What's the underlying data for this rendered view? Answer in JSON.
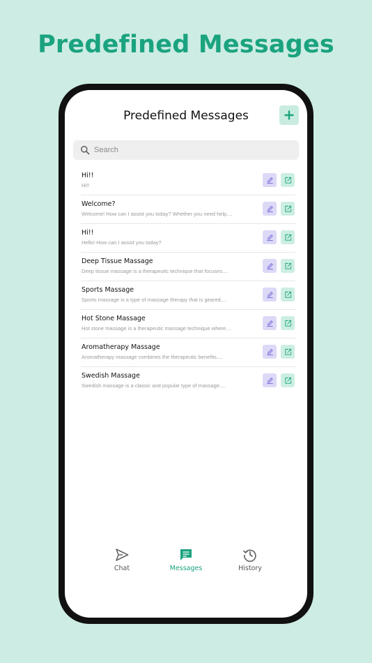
{
  "hero": {
    "title": "Predefined Messages"
  },
  "header": {
    "title": "Predefined Messages",
    "add_icon": "plus-icon"
  },
  "search": {
    "placeholder": "Search",
    "icon": "search-icon"
  },
  "messages": [
    {
      "title": "Hi!!",
      "preview": "Hi!!"
    },
    {
      "title": "Welcome?",
      "preview": "Welcome! How can I assist you today? Whether you need help...."
    },
    {
      "title": "Hi!!",
      "preview": "Hello! How can I assist you today?"
    },
    {
      "title": "Deep Tissue Massage",
      "preview": "Deep tissue massage is a therapeutic technique that focuses...."
    },
    {
      "title": "Sports Massage",
      "preview": "Sports massage is a type of massage therapy that is geared...."
    },
    {
      "title": "Hot Stone Massage",
      "preview": "Hot stone massage is a therapeutic massage technique where...."
    },
    {
      "title": "Aromatherapy Massage",
      "preview": "Aromatherapy massage combines the therapeutic benefits...."
    },
    {
      "title": "Swedish Massage",
      "preview": "Swedish massage is a classic and popular type of massage...."
    }
  ],
  "nav": {
    "items": [
      {
        "label": "Chat",
        "icon": "send-icon",
        "active": false
      },
      {
        "label": "Messages",
        "icon": "message-icon",
        "active": true
      },
      {
        "label": "History",
        "icon": "history-icon",
        "active": false
      }
    ]
  },
  "colors": {
    "accent": "#1aa37f",
    "background": "#cdece4",
    "edit_bg": "#dcd9f7",
    "edit_icon": "#6b5fd6",
    "share_bg": "#cdeee2",
    "share_icon": "#1aa37f"
  }
}
